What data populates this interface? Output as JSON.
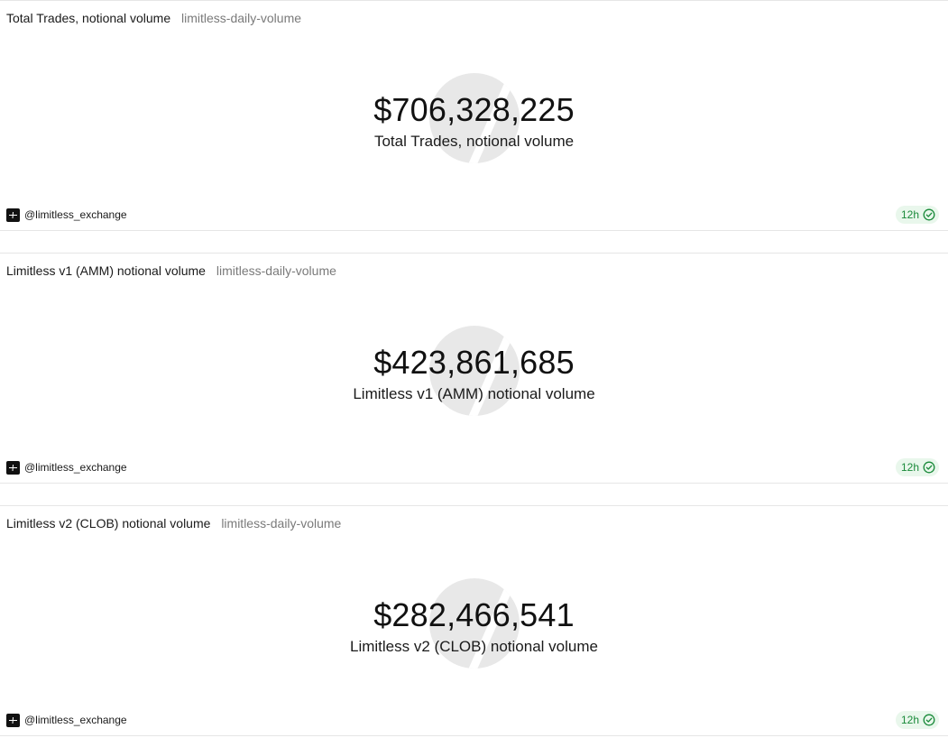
{
  "cards": [
    {
      "title": "Total Trades, notional volume",
      "query": "limitless-daily-volume",
      "value": "$706,328,225",
      "label": "Total Trades, notional volume",
      "author": "@limitless_exchange",
      "refresh": "12h"
    },
    {
      "title": "Limitless v1 (AMM) notional volume",
      "query": "limitless-daily-volume",
      "value": "$423,861,685",
      "label": "Limitless v1 (AMM) notional volume",
      "author": "@limitless_exchange",
      "refresh": "12h"
    },
    {
      "title": "Limitless v2 (CLOB) notional volume",
      "query": "limitless-daily-volume",
      "value": "$282,466,541",
      "label": "Limitless v2 (CLOB) notional volume",
      "author": "@limitless_exchange",
      "refresh": "12h"
    }
  ],
  "icons": {
    "avatar": "limitless-logo-icon",
    "refresh_status": "check-circle-icon"
  },
  "colors": {
    "badge_text": "#1a8a3a",
    "badge_bg": "#e9f7ec",
    "watermark": "#e8e8e8"
  }
}
